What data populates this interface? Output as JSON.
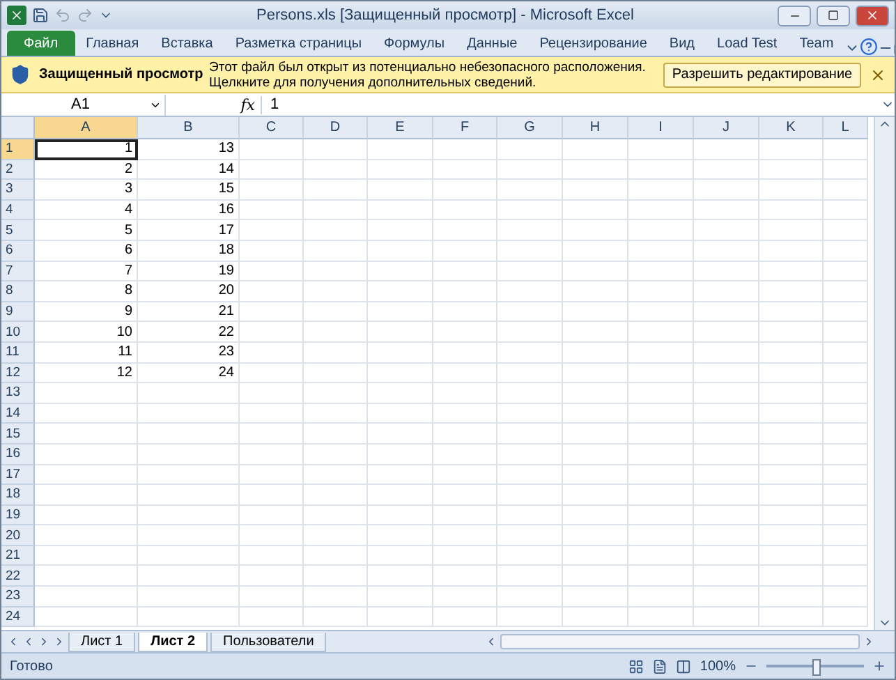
{
  "window": {
    "title": "Persons.xls  [Защищенный просмотр]  -  Microsoft Excel"
  },
  "ribbon_tabs": [
    {
      "label": "Файл",
      "kind": "file",
      "selected": false
    },
    {
      "label": "Главная",
      "kind": "tab",
      "selected": false
    },
    {
      "label": "Вставка",
      "kind": "tab",
      "selected": false
    },
    {
      "label": "Разметка страницы",
      "kind": "tab",
      "selected": false
    },
    {
      "label": "Формулы",
      "kind": "tab",
      "selected": false
    },
    {
      "label": "Данные",
      "kind": "tab",
      "selected": false
    },
    {
      "label": "Рецензирование",
      "kind": "tab",
      "selected": false
    },
    {
      "label": "Вид",
      "kind": "tab",
      "selected": false
    },
    {
      "label": "Load Test",
      "kind": "tab",
      "selected": false
    },
    {
      "label": "Team",
      "kind": "tab",
      "selected": false
    }
  ],
  "message_bar": {
    "title": "Защищенный просмотр",
    "text": "Этот файл был открыт из потенциально небезопасного расположения. Щелкните для получения дополнительных сведений.",
    "button": "Разрешить редактирование"
  },
  "formula_bar": {
    "name_box": "A1",
    "function_label": "fx",
    "value": "1"
  },
  "columns": [
    {
      "label": "A",
      "selected": true
    },
    {
      "label": "B",
      "selected": false
    },
    {
      "label": "C",
      "selected": false
    },
    {
      "label": "D",
      "selected": false
    },
    {
      "label": "E",
      "selected": false
    },
    {
      "label": "F",
      "selected": false
    },
    {
      "label": "G",
      "selected": false
    },
    {
      "label": "H",
      "selected": false
    },
    {
      "label": "I",
      "selected": false
    },
    {
      "label": "J",
      "selected": false
    },
    {
      "label": "K",
      "selected": false
    },
    {
      "label": "L",
      "selected": false
    }
  ],
  "rows": [
    {
      "label": "1",
      "selected": true,
      "cells": [
        "1",
        "13"
      ]
    },
    {
      "label": "2",
      "selected": false,
      "cells": [
        "2",
        "14"
      ]
    },
    {
      "label": "3",
      "selected": false,
      "cells": [
        "3",
        "15"
      ]
    },
    {
      "label": "4",
      "selected": false,
      "cells": [
        "4",
        "16"
      ]
    },
    {
      "label": "5",
      "selected": false,
      "cells": [
        "5",
        "17"
      ]
    },
    {
      "label": "6",
      "selected": false,
      "cells": [
        "6",
        "18"
      ]
    },
    {
      "label": "7",
      "selected": false,
      "cells": [
        "7",
        "19"
      ]
    },
    {
      "label": "8",
      "selected": false,
      "cells": [
        "8",
        "20"
      ]
    },
    {
      "label": "9",
      "selected": false,
      "cells": [
        "9",
        "21"
      ]
    },
    {
      "label": "10",
      "selected": false,
      "cells": [
        "10",
        "22"
      ]
    },
    {
      "label": "11",
      "selected": false,
      "cells": [
        "11",
        "23"
      ]
    },
    {
      "label": "12",
      "selected": false,
      "cells": [
        "12",
        "24"
      ]
    },
    {
      "label": "13",
      "selected": false,
      "cells": []
    },
    {
      "label": "14",
      "selected": false,
      "cells": []
    },
    {
      "label": "15",
      "selected": false,
      "cells": []
    },
    {
      "label": "16",
      "selected": false,
      "cells": []
    },
    {
      "label": "17",
      "selected": false,
      "cells": []
    },
    {
      "label": "18",
      "selected": false,
      "cells": []
    },
    {
      "label": "19",
      "selected": false,
      "cells": []
    },
    {
      "label": "20",
      "selected": false,
      "cells": []
    },
    {
      "label": "21",
      "selected": false,
      "cells": []
    },
    {
      "label": "22",
      "selected": false,
      "cells": []
    },
    {
      "label": "23",
      "selected": false,
      "cells": []
    },
    {
      "label": "24",
      "selected": false,
      "cells": []
    }
  ],
  "sheet_tabs": [
    {
      "label": "Лист 1",
      "selected": false
    },
    {
      "label": "Лист 2",
      "selected": true
    },
    {
      "label": "Пользователи",
      "selected": false
    }
  ],
  "status_bar": {
    "status": "Готово",
    "zoom": "100%",
    "zoom_level": {
      "level": 0.5
    }
  }
}
